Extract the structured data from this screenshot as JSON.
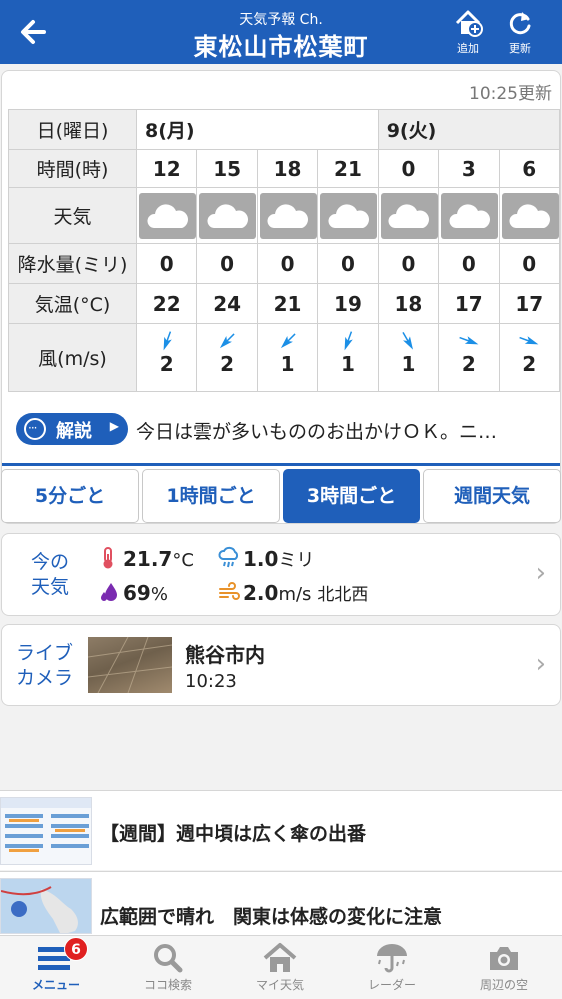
{
  "header": {
    "subtitle": "天気予報 Ch.",
    "title": "東松山市松葉町",
    "add_label": "追加",
    "refresh_label": "更新"
  },
  "forecast": {
    "updated": "10:25更新",
    "row_labels": {
      "date": "日(曜日)",
      "time": "時間(時)",
      "weather": "天気",
      "rain": "降水量(ミリ)",
      "temp": "気温(°C)",
      "wind": "風(m/s)"
    },
    "day1": "8(月)",
    "day2": "9(火)",
    "times": [
      "12",
      "15",
      "18",
      "21",
      "0",
      "3",
      "6"
    ],
    "weather_icons": [
      "cloud-icon",
      "cloud-icon",
      "cloud-icon",
      "cloud-icon",
      "cloud-icon",
      "cloud-icon",
      "cloud-icon"
    ],
    "rain": [
      "0",
      "0",
      "0",
      "0",
      "0",
      "0",
      "0"
    ],
    "temp": [
      "22",
      "24",
      "21",
      "19",
      "18",
      "17",
      "17"
    ],
    "wind_speed": [
      "2",
      "2",
      "1",
      "1",
      "1",
      "2",
      "2"
    ],
    "wind_arrow_deg": [
      200,
      225,
      225,
      200,
      150,
      110,
      110
    ],
    "comment_button": "解説",
    "comment": "今日は雲が多いもののお出かけＯＫ。ニ…"
  },
  "tabs": [
    "5分ごと",
    "1時間ごと",
    "3時間ごと",
    "週間天気"
  ],
  "active_tab": 2,
  "current": {
    "label_line1": "今の",
    "label_line2": "天気",
    "temp": "21.7",
    "temp_unit": "°C",
    "rain": "1.0",
    "rain_unit": "ミリ",
    "humidity": "69",
    "humidity_unit": "%",
    "wind": "2.0",
    "wind_unit": "m/s",
    "wind_dir": "北北西"
  },
  "camera": {
    "label_line1": "ライブ",
    "label_line2": "カメラ",
    "name": "熊谷市内",
    "time": "10:23"
  },
  "news": [
    {
      "title": "【週間】週中頃は広く傘の出番"
    },
    {
      "title": "広範囲で晴れ　関東は体感の変化に注意"
    }
  ],
  "nav": {
    "items": [
      "メニュー",
      "ココ検索",
      "マイ天気",
      "レーダー",
      "周辺の空"
    ],
    "badge": "6"
  },
  "colors": {
    "brand": "#1f5fba",
    "wind_arrow": "#1b8fe6",
    "badge": "#e02020"
  }
}
